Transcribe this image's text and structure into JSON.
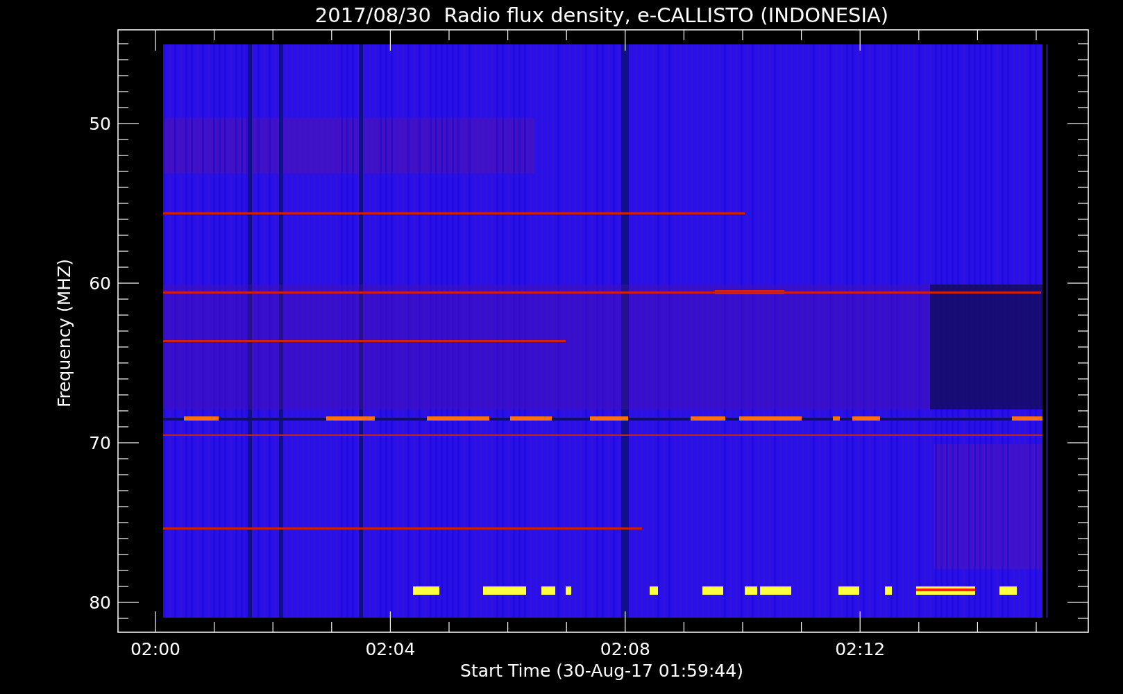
{
  "title": "2017/08/30  Radio flux density, e-CALLISTO (INDONESIA)",
  "y_axis": {
    "label": "Frequency (MHZ)",
    "ticks": [
      "50",
      "60",
      "70",
      "80"
    ]
  },
  "x_axis": {
    "label": "Start Time (30-Aug-17 01:59:44)",
    "ticks": [
      "02:00",
      "02:04",
      "02:08",
      "02:12"
    ]
  }
}
